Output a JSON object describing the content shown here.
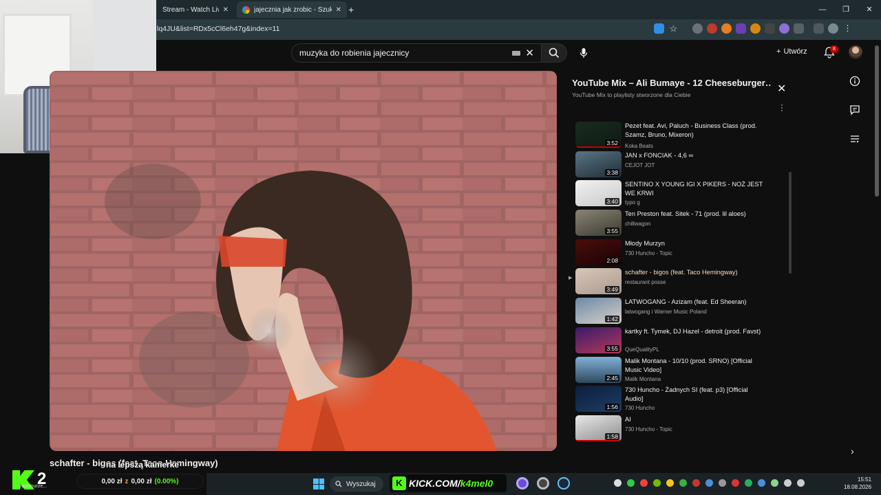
{
  "browser": {
    "tabs": [
      {
        "title": "Stream - Watch Live on ·"
      },
      {
        "title": "jajecznia jak zrobic - Szukaj w G"
      }
    ],
    "url_fragment": "lq4JU&list=RDx5cCl6eh47g&index=11"
  },
  "youtube": {
    "search_value": "muzyka do robienia jajecznicy",
    "create_label": "Utwórz",
    "notification_count": "8"
  },
  "video": {
    "title": "schafter - bigos (feat. Taco Hemingway)"
  },
  "playlist": {
    "title": "YouTube Mix – Ali Bumaye - 12 Cheeseburger…",
    "subtitle": "YouTube Mix to playlisty stworzone dla Ciebie",
    "items": [
      {
        "title": "Pezet feat. Avi, Paluch - Business Class (prod. Szamz, Bruno, Mixeron)",
        "channel": "Koka Beats",
        "duration": "3:52"
      },
      {
        "title": "JAN x FONCIAK - 4,6 ∞",
        "channel": "CEJOT JOT",
        "duration": "3:38"
      },
      {
        "title": "SENTINO X YOUNG IGI X PIKERS - NOŻ JEST WE KRWI",
        "channel": "typo g",
        "duration": "3:40"
      },
      {
        "title": "Ten Preston feat. Sitek - 71 (prod. lil aloes)",
        "channel": "chillwagon",
        "duration": "3:55"
      },
      {
        "title": "Młody Murzyn",
        "channel": "730 Huncho - Topic",
        "duration": "2:08"
      },
      {
        "title": "schafter - bigos (feat. Taco Hemingway)",
        "channel": "restaurant posse",
        "duration": "3:49"
      },
      {
        "title": "LATWOGANG - Azizam (feat. Ed Sheeran)",
        "channel": "latwogang i Warner Music Poland",
        "duration": "1:42"
      },
      {
        "title": "kartky ft. Tymek, DJ Hazel - detroit (prod. Favst)",
        "channel": "QueQualityPL",
        "duration": "3:55"
      },
      {
        "title": "Malik Montana - 10/10 (prod. SRNO) [Official Music Video]",
        "channel": "Malik Montana",
        "duration": "2:45"
      },
      {
        "title": "730 Huncho - Żadnych SI (feat. p3) [Official Audio]",
        "channel": "730 Huncho",
        "duration": "1:56"
      },
      {
        "title": "AI",
        "channel": "730 Huncho - Topic",
        "duration": "1:58"
      }
    ]
  },
  "overlay": {
    "viewer_count": "2",
    "caption": "na lepszą kamerke",
    "small_text": "zachmurze...",
    "money_a": "0,00 zł",
    "money_sep": "z",
    "money_b": "0,00 zł",
    "money_pct": "(0.00%)"
  },
  "taskbar": {
    "search_label": "Wyszukaj",
    "kick_text": "KICK.COM/",
    "kick_user": "k4mel0",
    "time": "15:51",
    "date": "18.08.2026"
  },
  "colors": {
    "youtube_bg": "#0f0f0f",
    "kick_green": "#53fc18",
    "youtube_red": "#cc0000",
    "shirt_orange": "#e2552e"
  }
}
